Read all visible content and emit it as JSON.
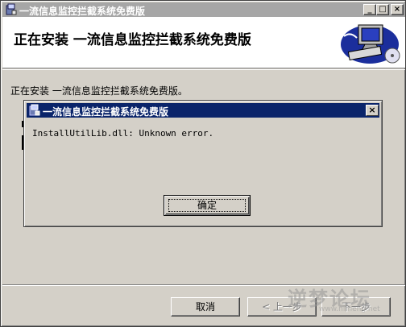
{
  "window": {
    "title": "一流信息监控拦截系统免费版",
    "caption_buttons": [
      "_",
      "□",
      "×"
    ]
  },
  "banner": {
    "title": "正在安装  一流信息监控拦截系统免费版"
  },
  "status_text": "正在安装 一流信息监控拦截系统免费版。",
  "dialog": {
    "title": "一流信息监控拦截系统免费版",
    "close": "×",
    "message": "InstallUtilLib.dll: Unknown error.",
    "ok_label": "确定"
  },
  "buttons": {
    "cancel": "取消",
    "back": "< 上一步",
    "next": "下一步"
  },
  "watermark": {
    "text": "逆梦论坛",
    "sub": "www.nimeng.net"
  }
}
